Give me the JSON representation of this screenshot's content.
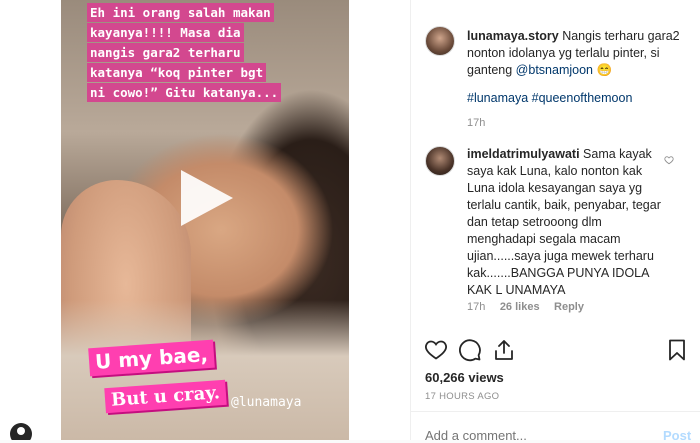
{
  "story": {
    "caption_lines": [
      "Eh ini orang salah makan",
      "kayanya!!!! Masa dia",
      "nangis gara2 terharu",
      "katanya “koq pinter bgt",
      "ni cowo!” Gitu katanya..."
    ],
    "sticker_1": "U my bae,",
    "sticker_2": "But u cray.",
    "mention_tag": "@lunamaya"
  },
  "post": {
    "author": "lunamaya.story",
    "caption": "Nangis terharu gara2 nonton idolanya yg terlalu pinter, si ganteng",
    "caption_mention": "@btsnamjoon",
    "caption_emoji": "😁",
    "hashtags": "#lunamaya #queenofthemoon",
    "caption_time": "17h"
  },
  "comment": {
    "author": "imeldatrimulyawati",
    "text": "Sama kayak saya kak Luna, kalo nonton kak Luna idola kesayangan saya yg terlalu cantik, baik, penyabar, tegar dan tetap setrooong dlm menghadapi segala macam ujian......saya juga mewek terharu kak.......BANGGA PUNYA IDOLA KAK L UNAMAYA",
    "time": "17h",
    "likes": "26 likes",
    "reply_label": "Reply"
  },
  "stats": {
    "views": "60,266 views",
    "timestamp": "17 HOURS AGO"
  },
  "composer": {
    "placeholder": "Add a comment...",
    "post_label": "Post"
  },
  "icons": [
    "heart-icon",
    "comment-icon",
    "share-icon",
    "bookmark-icon",
    "play-icon"
  ],
  "colors": {
    "caption_bg": "#d3488f",
    "sticker_bg": "#ff3fb0",
    "link": "#00376b",
    "muted": "#8e8e8e"
  }
}
